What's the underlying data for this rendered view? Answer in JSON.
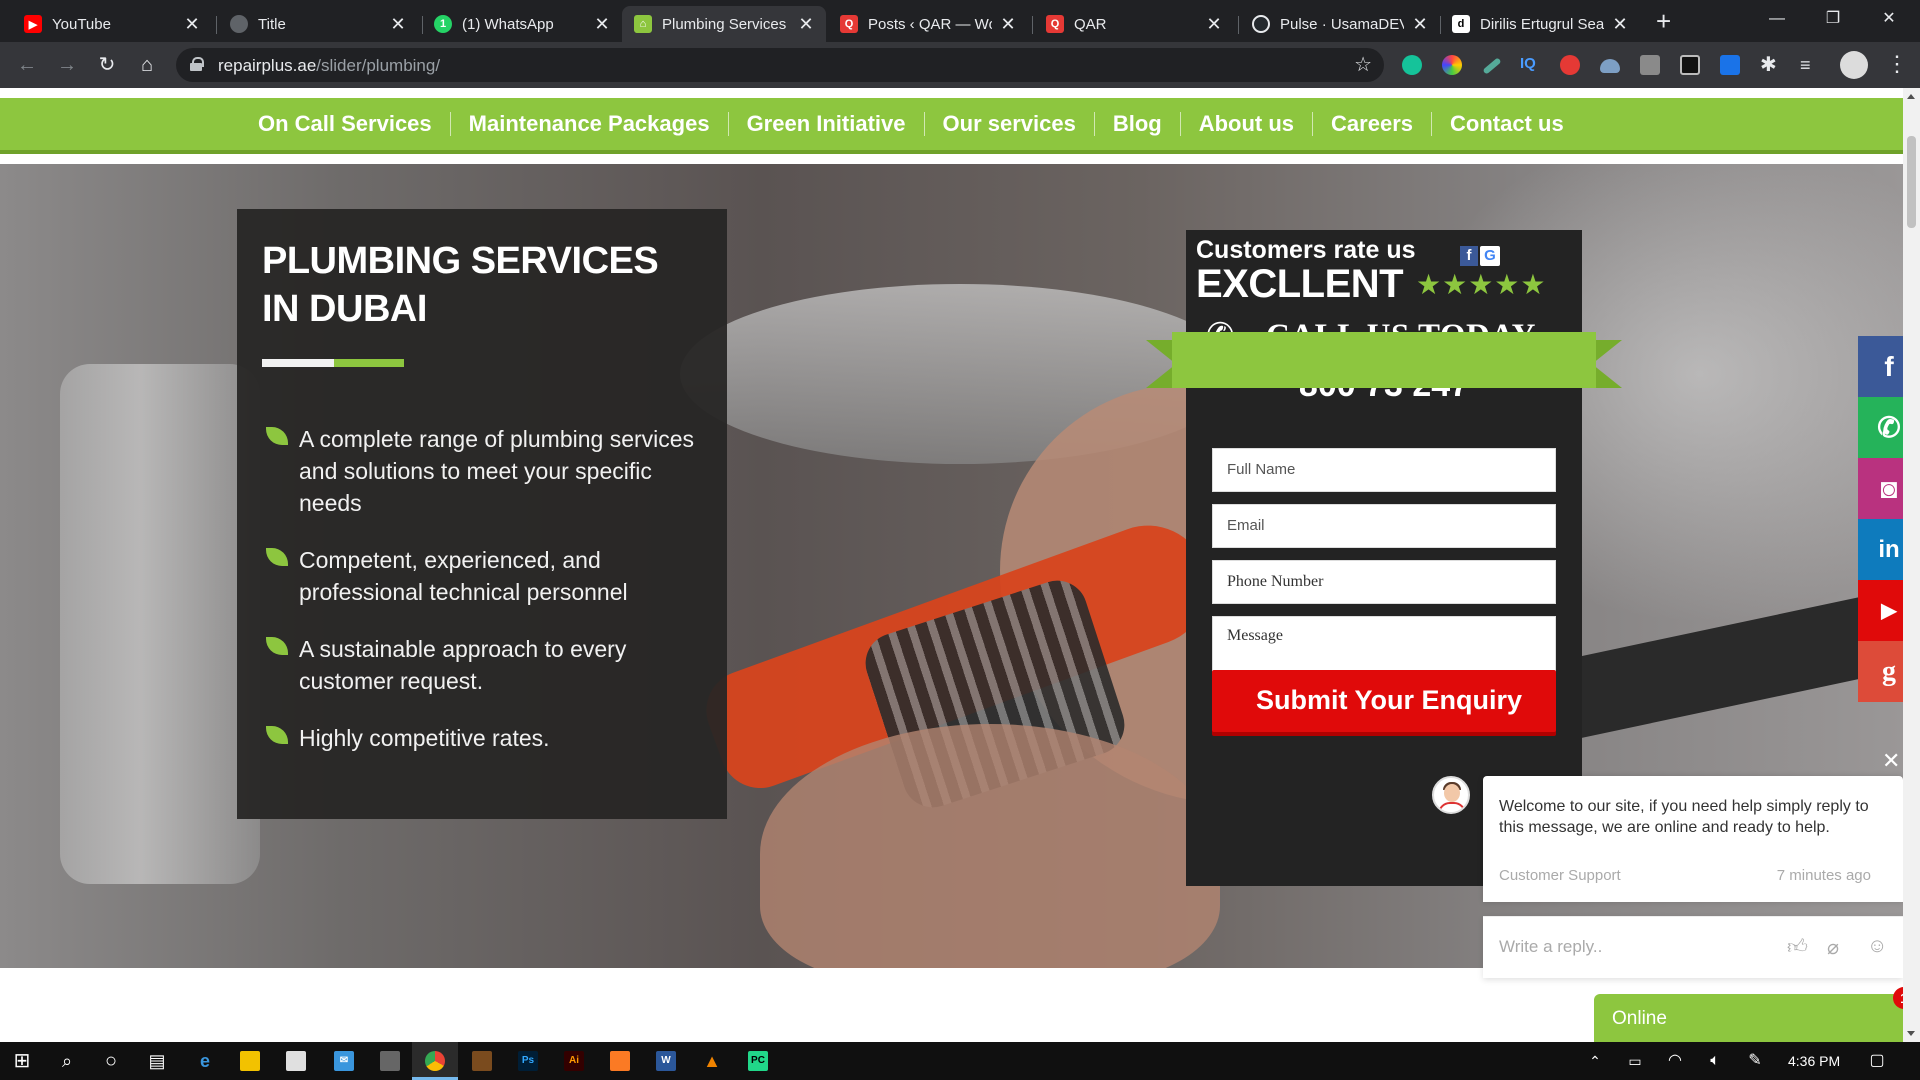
{
  "browser": {
    "tabs": [
      {
        "label": "YouTube",
        "favicon": "youtube-icon",
        "color": "#ff0000",
        "glyph": "▶"
      },
      {
        "label": "Title",
        "favicon": "globe-icon",
        "color": "#5f6368",
        "glyph": "◍"
      },
      {
        "label": "(1) WhatsApp",
        "favicon": "whatsapp-icon",
        "color": "#25d366",
        "glyph": "1"
      },
      {
        "label": "Plumbing Services",
        "favicon": "home-icon",
        "color": "#8dc63f",
        "glyph": "⌂"
      },
      {
        "label": "Posts ‹ QAR — Wo",
        "favicon": "q-icon",
        "color": "#e53935",
        "glyph": "Q"
      },
      {
        "label": "QAR",
        "favicon": "q-icon",
        "color": "#e53935",
        "glyph": "Q"
      },
      {
        "label": "Pulse · UsamaDEV",
        "favicon": "github-icon",
        "color": "#24292e",
        "glyph": "●"
      },
      {
        "label": "Dirilis Ertugrul Sea",
        "favicon": "d-icon",
        "color": "#ffffff",
        "glyph": "d"
      }
    ],
    "url_host": "repairplus.ae",
    "url_path": "/slider/plumbing/"
  },
  "nav": {
    "items": [
      "On Call Services",
      "Maintenance Packages",
      "Green Initiative",
      "Our services",
      "Blog",
      "About us",
      "Careers",
      "Contact us"
    ]
  },
  "info": {
    "title_line1": "PLUMBING SERVICES",
    "title_line2": "IN DUBAI",
    "features": [
      "A complete range of plumbing services and solutions to meet your specific needs",
      "Competent, experienced, and professional technical personnel",
      "A sustainable approach to every customer request.",
      "Highly competitive rates."
    ]
  },
  "rating": {
    "line1": "Customers rate us",
    "line2": "EXCLLENT",
    "stars": "★★★★★",
    "call": "CALL US TODAY",
    "number": "800 73 247"
  },
  "form": {
    "full_name": "Full Name",
    "email": "Email",
    "phone": "Phone Number",
    "message": "Message",
    "submit": "Submit Your Enquiry"
  },
  "social": [
    {
      "name": "facebook",
      "glyph": "f",
      "color": "#3b5998"
    },
    {
      "name": "whatsapp",
      "glyph": "✆",
      "color": "#25b35a"
    },
    {
      "name": "instagram",
      "glyph": "◙",
      "color": "#b9327f"
    },
    {
      "name": "linkedin",
      "glyph": "in",
      "color": "#0e7bbd"
    },
    {
      "name": "youtube",
      "glyph": "▶",
      "color": "#e00a0a"
    },
    {
      "name": "google-plus",
      "glyph": "g",
      "color": "#dd4b39"
    }
  ],
  "chat": {
    "message": "Welcome to our site, if you need help simply reply to this message, we are online and ready to help.",
    "sender": "Customer Support",
    "time": "7 minutes ago",
    "reply_placeholder": "Write a reply..",
    "status": "Online",
    "badge": "1"
  },
  "taskbar": {
    "time": "4:36 PM"
  }
}
